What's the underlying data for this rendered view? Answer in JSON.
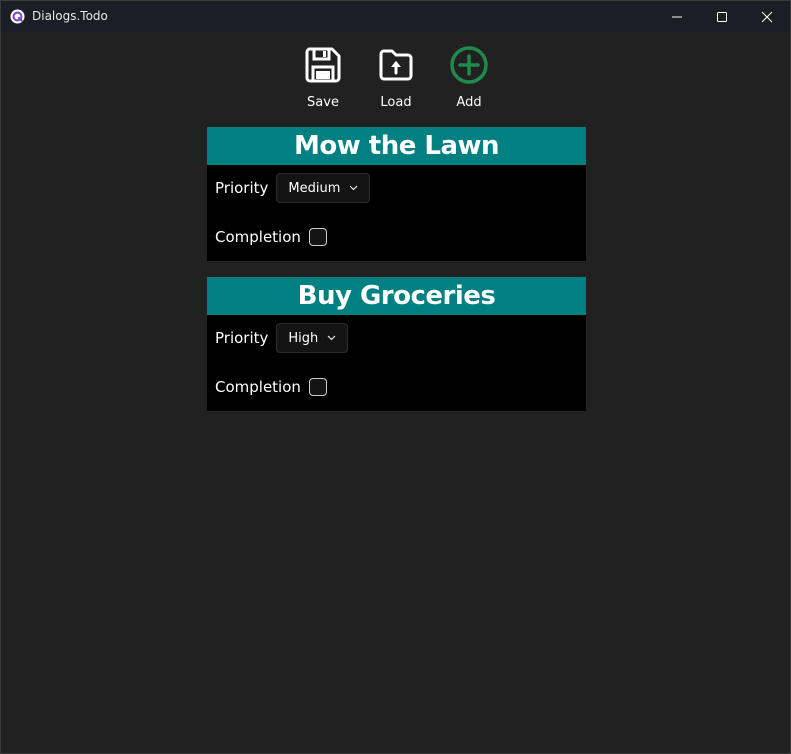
{
  "window": {
    "title": "Dialogs.Todo"
  },
  "toolbar": {
    "save_label": "Save",
    "load_label": "Load",
    "add_label": "Add"
  },
  "colors": {
    "header_teal": "#008080",
    "add_green": "#1e8a4e",
    "background": "#212121",
    "card_body": "#000000"
  },
  "todos": [
    {
      "title": "Mow the Lawn",
      "priority_label": "Priority",
      "priority_value": "Medium",
      "completion_label": "Completion",
      "completed": false
    },
    {
      "title": "Buy Groceries",
      "priority_label": "Priority",
      "priority_value": "High",
      "completion_label": "Completion",
      "completed": false
    }
  ]
}
